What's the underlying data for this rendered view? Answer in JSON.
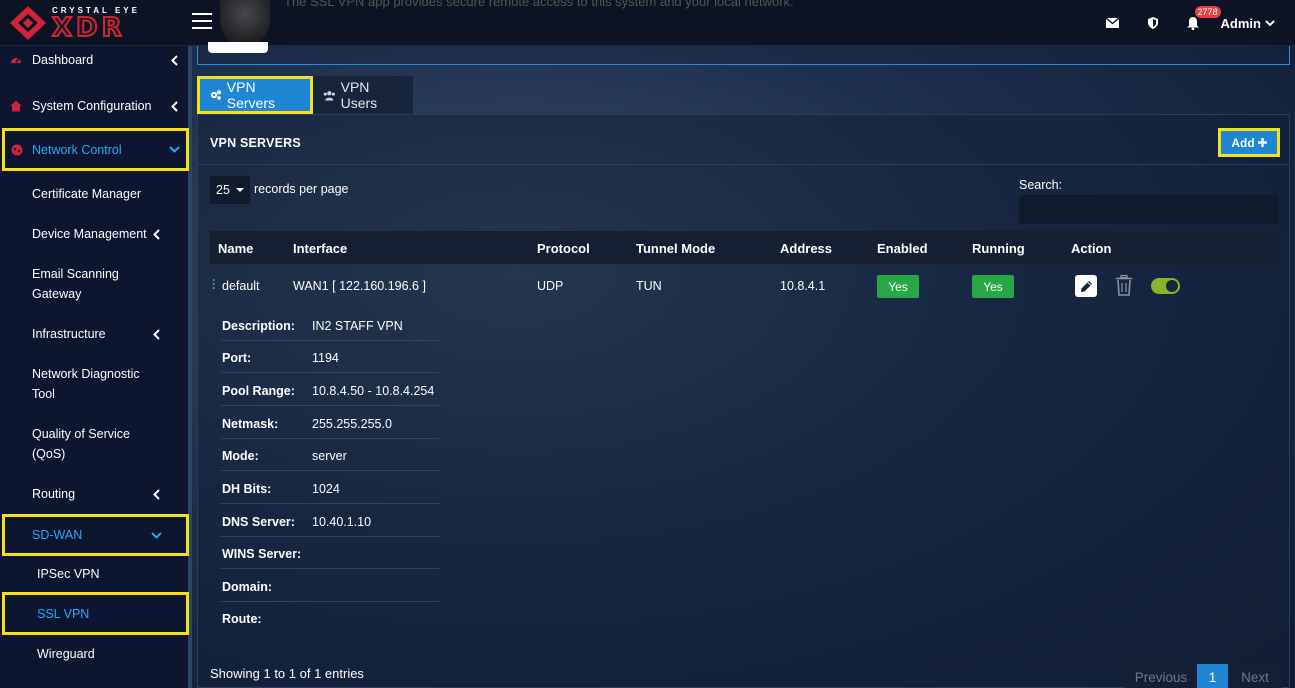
{
  "brand": {
    "small": "CRYSTAL EYE",
    "big": "XDR"
  },
  "banner_text": "The SSL VPN app provides secure remote access to this system and your local network.",
  "header": {
    "notifications_count": "2778",
    "user": "Admin"
  },
  "sidebar": {
    "items": [
      {
        "label": "Dashboard"
      },
      {
        "label": "System Configuration"
      },
      {
        "label": "Network Control"
      },
      {
        "label": "Certificate Manager"
      },
      {
        "label": "Device Management"
      },
      {
        "label": "Email Scanning Gateway"
      },
      {
        "label": "Infrastructure"
      },
      {
        "label": "Network Diagnostic Tool"
      },
      {
        "label": "Quality of Service (QoS)"
      },
      {
        "label": "Routing"
      },
      {
        "label": "SD-WAN"
      },
      {
        "label": "IPSec VPN"
      },
      {
        "label": "SSL VPN"
      },
      {
        "label": "Wireguard"
      }
    ]
  },
  "tabs": [
    {
      "label": "VPN Servers"
    },
    {
      "label": "VPN Users"
    }
  ],
  "panel": {
    "title": "VPN SERVERS",
    "add_label": "Add",
    "records_per_page": "25",
    "records_label": "records per page",
    "search_label": "Search:",
    "search_value": ""
  },
  "table": {
    "columns": [
      "Name",
      "Interface",
      "Protocol",
      "Tunnel Mode",
      "Address",
      "Enabled",
      "Running",
      "Action"
    ],
    "rows": [
      {
        "name": "default",
        "interface": "WAN1 [ 122.160.196.6 ]",
        "protocol": "UDP",
        "tunnel_mode": "TUN",
        "address": "10.8.4.1",
        "enabled": "Yes",
        "running": "Yes"
      }
    ]
  },
  "details": [
    {
      "key": "Description:",
      "value": "IN2 STAFF VPN"
    },
    {
      "key": "Port:",
      "value": "1194"
    },
    {
      "key": "Pool Range:",
      "value": "10.8.4.50 - 10.8.4.254"
    },
    {
      "key": "Netmask:",
      "value": "255.255.255.0"
    },
    {
      "key": "Mode:",
      "value": "server"
    },
    {
      "key": "DH Bits:",
      "value": "1024"
    },
    {
      "key": "DNS Server:",
      "value": "10.40.1.10"
    },
    {
      "key": "WINS Server:",
      "value": ""
    },
    {
      "key": "Domain:",
      "value": ""
    },
    {
      "key": "Route:",
      "value": ""
    }
  ],
  "footer": {
    "showing": "Showing 1 to 1 of 1 entries",
    "previous": "Previous",
    "current_page": "1",
    "next": "Next"
  },
  "colors": {
    "accent": "#1f86d4",
    "highlight": "#f5e11a",
    "success": "#28a745",
    "brand_red": "#d1233a"
  }
}
